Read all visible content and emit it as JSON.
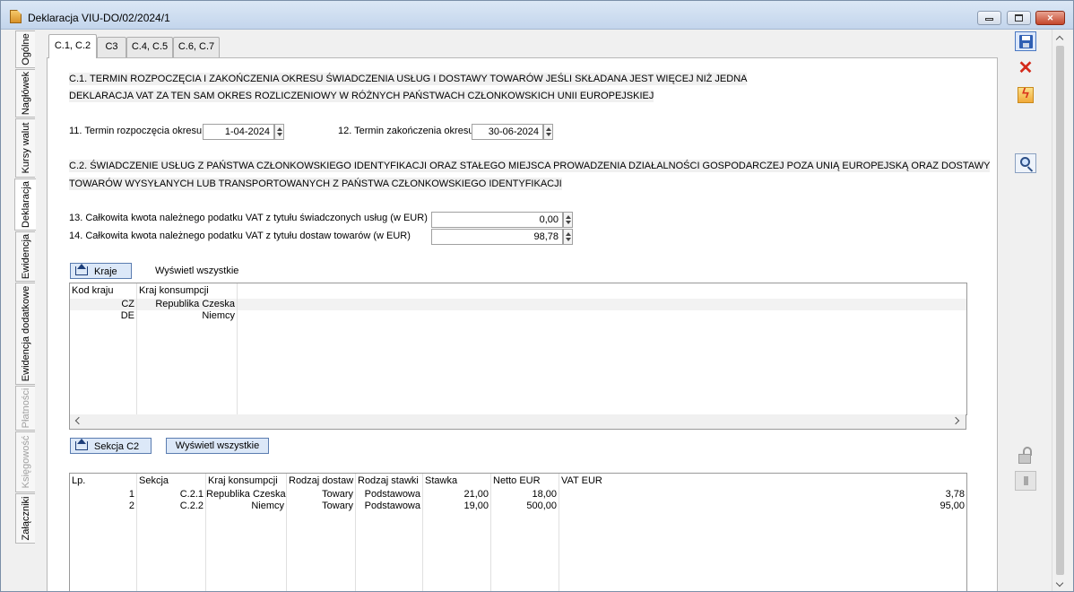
{
  "window": {
    "title": "Deklaracja VIU-DO/02/2024/1"
  },
  "side_tabs": [
    {
      "label": "Ogólne",
      "state": "normal"
    },
    {
      "label": "Nagłówek",
      "state": "normal"
    },
    {
      "label": "Kursy walut",
      "state": "normal"
    },
    {
      "label": "Deklaracja",
      "state": "active"
    },
    {
      "label": "Ewidencja",
      "state": "normal"
    },
    {
      "label": "Ewidencja dodatkowe",
      "state": "normal"
    },
    {
      "label": "Płatności",
      "state": "disabled"
    },
    {
      "label": "Księgowość",
      "state": "disabled"
    },
    {
      "label": "Załączniki",
      "state": "normal"
    }
  ],
  "top_tabs": [
    {
      "label": "C.1, C.2",
      "active": true
    },
    {
      "label": "C3",
      "active": false
    },
    {
      "label": "C.4, C.5",
      "active": false
    },
    {
      "label": "C.6, C.7",
      "active": false
    }
  ],
  "section_c1": {
    "line1": "C.1. TERMIN ROZPOCZĘCIA I ZAKOŃCZENIA OKRESU ŚWIADCZENIA USŁUG I DOSTAWY TOWARÓW JEŚLI SKŁADANA JEST WIĘCEJ NIŻ JEDNA",
    "line2": "DEKLARACJA VAT ZA TEN SAM OKRES ROZLICZENIOWY W RÓŻNYCH PAŃSTWACH CZŁONKOWSKICH UNII EUROPEJSKIEJ",
    "start_label": "11. Termin rozpoczęcia okresu",
    "start_value": "1-04-2024",
    "end_label": "12. Termin zakończenia okresu",
    "end_value": "30-06-2024"
  },
  "section_c2": {
    "line1": "C.2. ŚWIADCZENIE USŁUG Z PAŃSTWA CZŁONKOWSKIEGO IDENTYFIKACJI ORAZ STAŁEGO MIEJSCA PROWADZENIA DZIAŁALNOŚCI GOSPODARCZEJ POZA UNIĄ EUROPEJSKĄ ORAZ DOSTAWY",
    "line2": "TOWARÓW WYSYŁANYCH LUB TRANSPORTOWANYCH Z PAŃSTWA CZŁONKOWSKIEGO IDENTYFIKACJI",
    "services_label": "13. Całkowita kwota należnego podatku VAT z tytułu świadczonych usług (w EUR)",
    "services_value": "0,00",
    "goods_label": "14. Całkowita kwota należnego podatku VAT z tytułu dostaw towarów (w EUR)",
    "goods_value": "98,78"
  },
  "countries": {
    "button_label": "Kraje",
    "show_all_label": "Wyświetl wszystkie",
    "columns": [
      "Kod kraju",
      "Kraj konsumpcji"
    ],
    "rows": [
      {
        "code": "CZ",
        "country": "Republika Czeska"
      },
      {
        "code": "DE",
        "country": "Niemcy"
      }
    ]
  },
  "c2_section": {
    "button_label": "Sekcja C2",
    "show_all_label": "Wyświetl wszystkie",
    "columns": [
      "Lp.",
      "Sekcja",
      "Kraj konsumpcji",
      "Rodzaj dostaw",
      "Rodzaj stawki",
      "Stawka",
      "Netto EUR",
      "VAT EUR"
    ],
    "rows": [
      {
        "lp": "1",
        "section": "C.2.1",
        "country": "Republika Czeska",
        "supply_type": "Towary",
        "rate_type": "Podstawowa",
        "rate": "21,00",
        "net": "18,00",
        "vat": "3,78"
      },
      {
        "lp": "2",
        "section": "C.2.2",
        "country": "Niemcy",
        "supply_type": "Towary",
        "rate_type": "Podstawowa",
        "rate": "19,00",
        "net": "500,00",
        "vat": "95,00"
      }
    ]
  },
  "toolbar": {
    "icons": [
      "save-icon",
      "delete-icon",
      "flash-icon",
      "search-icon",
      "lock-icon",
      "pin-icon"
    ],
    "delete_color": "#d42a1a"
  }
}
